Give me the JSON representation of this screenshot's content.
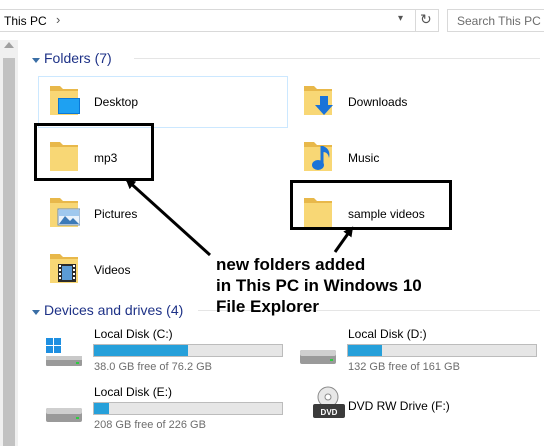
{
  "address_bar": {
    "location": "This PC",
    "search_placeholder": "Search This PC"
  },
  "folders": {
    "header": "Folders (7)",
    "items": [
      {
        "label": "Desktop",
        "icon": "desktop-folder-icon"
      },
      {
        "label": "Downloads",
        "icon": "downloads-folder-icon"
      },
      {
        "label": "mp3",
        "icon": "folder-icon"
      },
      {
        "label": "Music",
        "icon": "music-folder-icon"
      },
      {
        "label": "Pictures",
        "icon": "pictures-folder-icon"
      },
      {
        "label": "sample videos",
        "icon": "folder-icon"
      },
      {
        "label": "Videos",
        "icon": "videos-folder-icon"
      }
    ]
  },
  "drives": {
    "header": "Devices and drives (4)",
    "items": [
      {
        "label": "Local Disk (C:)",
        "free_text": "38.0 GB free of 76.2 GB",
        "used_fraction": 0.5,
        "icon": "windows-drive-icon"
      },
      {
        "label": "Local Disk (D:)",
        "free_text": "132 GB free of 161 GB",
        "used_fraction": 0.18,
        "icon": "hard-drive-icon"
      },
      {
        "label": "Local Disk (E:)",
        "free_text": "208 GB free of 226 GB",
        "used_fraction": 0.08,
        "icon": "hard-drive-icon"
      },
      {
        "label": "DVD RW Drive (F:)",
        "free_text": "",
        "icon": "dvd-drive-icon"
      }
    ]
  },
  "annotation": {
    "line1": "new folders added",
    "line2": "in This PC in Windows 10",
    "line3": "File Explorer"
  },
  "colors": {
    "folder_yellow": "#f8d775",
    "header_blue": "#1e3287",
    "progress_blue": "#26a0da"
  }
}
